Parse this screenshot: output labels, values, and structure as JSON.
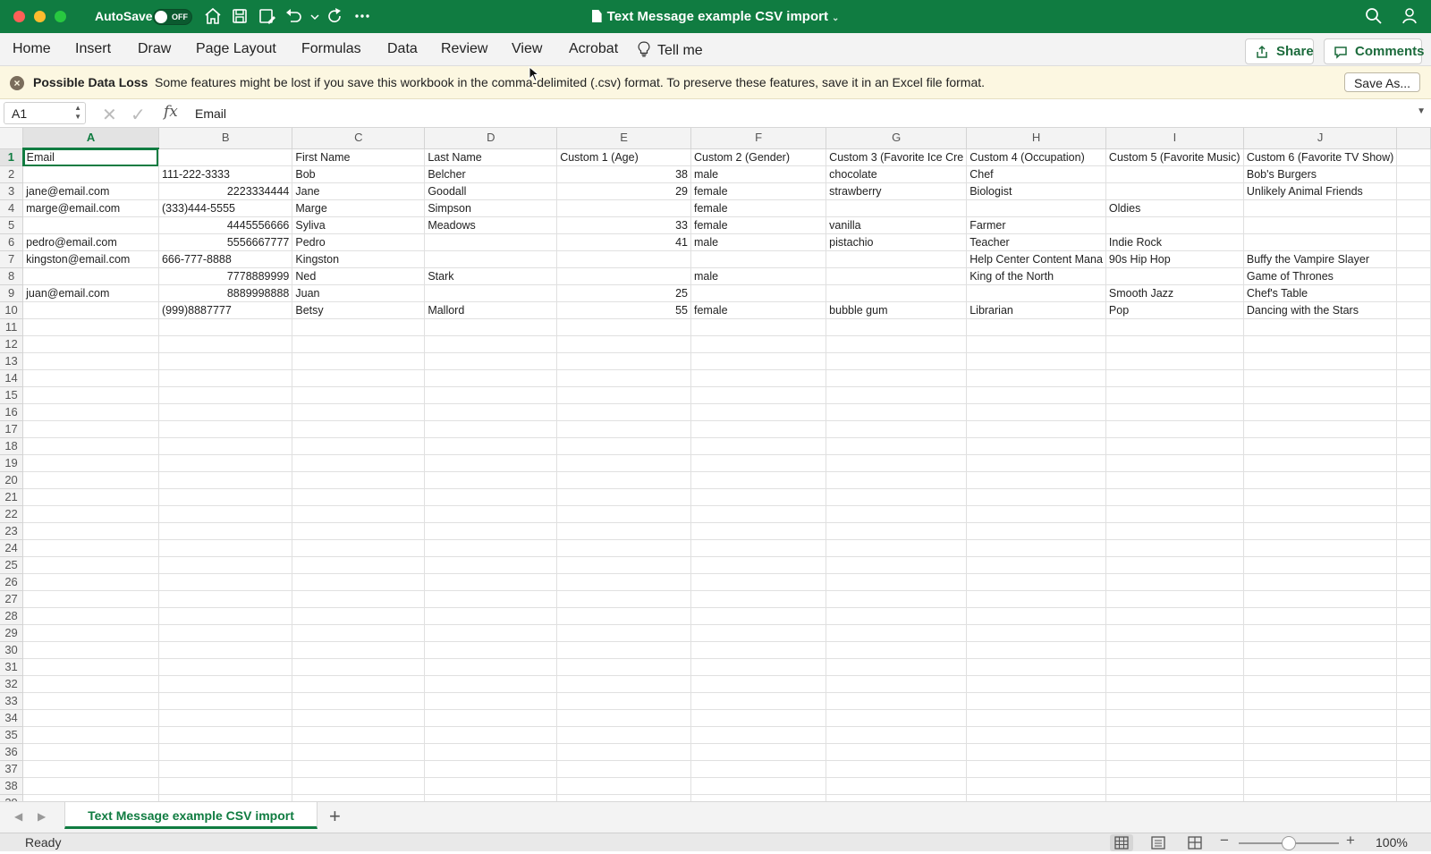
{
  "titlebar": {
    "autosave_label": "AutoSave",
    "autosave_state": "OFF",
    "document_title": "Text Message example CSV import"
  },
  "ribbon": {
    "tabs": [
      "Home",
      "Insert",
      "Draw",
      "Page Layout",
      "Formulas",
      "Data",
      "Review",
      "View",
      "Acrobat"
    ],
    "tell_me": "Tell me",
    "share_label": "Share",
    "comments_label": "Comments"
  },
  "infobar": {
    "heading": "Possible Data Loss",
    "message": "Some features might be lost if you save this workbook in the comma-delimited (.csv) format. To preserve these features, save it in an Excel file format.",
    "save_as_label": "Save As..."
  },
  "formula_bar": {
    "name_box": "A1",
    "fx_label": "fx",
    "value": "Email"
  },
  "sheet": {
    "active_cell": "A1",
    "columns": [
      "A",
      "B",
      "C",
      "D",
      "E",
      "F",
      "G",
      "H",
      "I",
      "J"
    ],
    "total_rows": 39,
    "rows": [
      [
        "Email",
        "",
        "First Name",
        "Last Name",
        "Custom 1 (Age)",
        "Custom 2 (Gender)",
        "Custom 3 (Favorite Ice Cre",
        "Custom 4 (Occupation)",
        "Custom 5 (Favorite Music)",
        "Custom 6 (Favorite TV Show)"
      ],
      [
        "",
        "111-222-3333",
        "Bob",
        "Belcher",
        "38",
        "male",
        "chocolate",
        "Chef",
        "",
        "Bob's Burgers"
      ],
      [
        "jane@email.com",
        "2223334444",
        "Jane",
        "Goodall",
        "29",
        "female",
        "strawberry",
        "Biologist",
        "",
        "Unlikely Animal Friends"
      ],
      [
        "marge@email.com",
        "(333)444-5555",
        "Marge",
        "Simpson",
        "",
        "female",
        "",
        "",
        "Oldies",
        ""
      ],
      [
        "",
        "4445556666",
        "Syliva",
        "Meadows",
        "33",
        "female",
        "vanilla",
        "Farmer",
        "",
        ""
      ],
      [
        "pedro@email.com",
        "5556667777",
        "Pedro",
        "",
        "41",
        "male",
        "pistachio",
        "Teacher",
        "Indie Rock",
        ""
      ],
      [
        "kingston@email.com",
        "666-777-8888",
        "Kingston",
        "",
        "",
        "",
        "",
        "Help Center Content Mana",
        "90s Hip Hop",
        "Buffy the Vampire Slayer"
      ],
      [
        "",
        "7778889999",
        "Ned",
        "Stark",
        "",
        "male",
        "",
        "King of the North",
        "",
        "Game of Thrones"
      ],
      [
        "juan@email.com",
        "8889998888",
        "Juan",
        "",
        "25",
        "",
        "",
        "",
        "Smooth Jazz",
        "Chef's Table"
      ],
      [
        "",
        "(999)8887777",
        "Betsy",
        "Mallord",
        "55",
        "female",
        "bubble gum",
        "Librarian",
        "Pop",
        "Dancing with the Stars"
      ]
    ]
  },
  "sheet_tabs": {
    "active": "Text Message example CSV import",
    "add_label": "+"
  },
  "statusbar": {
    "status": "Ready",
    "zoom": "100%",
    "zoom_fraction": 0.5
  },
  "colors": {
    "accent": "#107c41",
    "infobar_bg": "#fcf7e1"
  }
}
